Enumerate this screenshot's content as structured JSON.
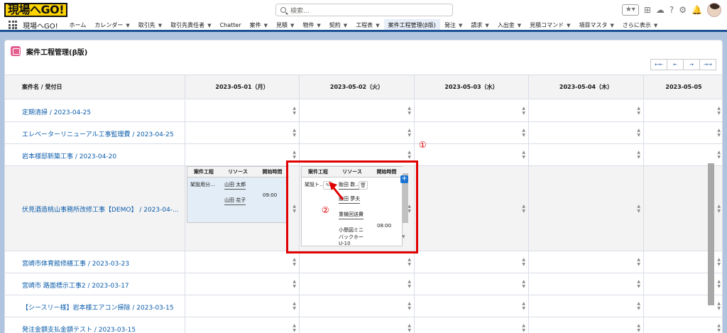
{
  "app": {
    "logo_text": "現場へGO!",
    "name": "現場へGO!",
    "search_placeholder": "検索..."
  },
  "nav": [
    {
      "label": "ホーム",
      "chevron": false
    },
    {
      "label": "カレンダー",
      "chevron": true
    },
    {
      "label": "取引先",
      "chevron": true
    },
    {
      "label": "取引先責任者",
      "chevron": true
    },
    {
      "label": "Chatter",
      "chevron": false
    },
    {
      "label": "案件",
      "chevron": true
    },
    {
      "label": "見積",
      "chevron": true
    },
    {
      "label": "物件",
      "chevron": true
    },
    {
      "label": "契約",
      "chevron": true
    },
    {
      "label": "工程表",
      "chevron": true
    },
    {
      "label": "案件工程管理(β版)",
      "chevron": false,
      "active": true
    },
    {
      "label": "発注",
      "chevron": true
    },
    {
      "label": "請求",
      "chevron": true
    },
    {
      "label": "入出金",
      "chevron": true
    },
    {
      "label": "見積コマンド",
      "chevron": true
    },
    {
      "label": "項目マスタ",
      "chevron": true
    },
    {
      "label": "さらに表示",
      "chevron": true
    }
  ],
  "page": {
    "title": "案件工程管理(β版)",
    "pager": [
      "←←",
      "←",
      "→",
      "→→"
    ]
  },
  "grid": {
    "first_header": "案件名 / 受付日",
    "dates": [
      "2023-05-01（月）",
      "2023-05-02（火）",
      "2023-05-03（水）",
      "2023-05-04（木）",
      "2023-05-05"
    ],
    "rows": [
      {
        "name": "定期清掃 / 2023-04-25"
      },
      {
        "name": "エレベーターリニューアル工事監理費 / 2023-04-25"
      },
      {
        "name": "岩本様邸新築工事 / 2023-04-20"
      },
      {
        "name": "伏見酒造桃山事務所改修工事【DEMO】 / 2023-04-..."
      },
      {
        "name": "宮崎市体育館修繕工事 / 2023-03-23"
      },
      {
        "name": "宮崎市 路面標示工事2 / 2023-03-17"
      },
      {
        "name": "【シースリー様】岩本様エアコン掃除 / 2023-03-15"
      },
      {
        "name": "発注金額支払金額テスト / 2023-03-15"
      }
    ],
    "inner_headers": [
      "案件工程",
      "リソース",
      "開始時間"
    ],
    "day1": {
      "process": "架設用分…",
      "resources": [
        "山田 太郎",
        "山田 花子"
      ],
      "start": "09:00"
    },
    "day2": {
      "process": "架設ト…",
      "resources": [
        "飯田 数…",
        "飯田 夢夫",
        "重機回送費",
        "小懸図ミニ",
        "バックホー",
        "U-10"
      ],
      "start": "08:00"
    }
  },
  "annotations": {
    "one": "①",
    "two": "②"
  }
}
